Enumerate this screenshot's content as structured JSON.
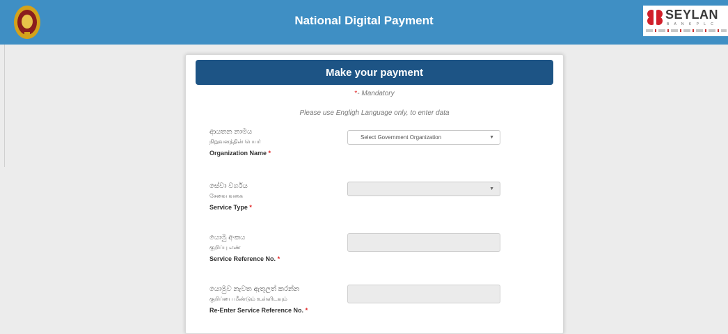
{
  "header": {
    "title": "National Digital Payment",
    "bank_name": "SEYLAN",
    "bank_subline": "B A N K P L C"
  },
  "card": {
    "title": "Make your payment",
    "mandatory_star": "*",
    "mandatory_text": "- Mandatory",
    "language_note": "Please use Engligh Language only, to enter data"
  },
  "fields": [
    {
      "si": "ආයතන නාමය",
      "ta": "நிறுவனத்தின் பெயர்",
      "en": "Organization Name",
      "star": "*",
      "value": "Select Government Organization"
    },
    {
      "si": "සේවා වර්ගය",
      "ta": "சேவை வகை",
      "en": "Service Type",
      "star": "*",
      "value": ""
    },
    {
      "si": "යොමු අංකය",
      "ta": "குறிப்பு எண்",
      "en": "Service Reference No.",
      "star": "*",
      "value": ""
    },
    {
      "si": "යොමුව නැවත ඇතුලත් කරන්න",
      "ta": "குறிப்பை மீண்டும் உள்ளிடவும்",
      "en": "Re-Enter Service Reference No.",
      "star": "*",
      "value": ""
    }
  ],
  "icons": {
    "emblem": "sri-lanka-emblem-icon",
    "bank_logo": "seylan-bank-logo",
    "dropdown": "chevron-down-icon"
  },
  "colors": {
    "topbar": "#3f8fc4",
    "card_header": "#1d5485",
    "required": "#e02020"
  }
}
